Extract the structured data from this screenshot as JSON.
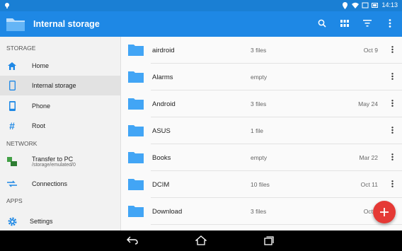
{
  "statusbar": {
    "time": "14:13"
  },
  "toolbar": {
    "title": "Internal storage"
  },
  "sidebar": {
    "sections": {
      "storage": "STORAGE",
      "network": "NETWORK",
      "apps": "APPS"
    },
    "items": [
      {
        "label": "Home",
        "icon": "home-icon"
      },
      {
        "label": "Internal storage",
        "icon": "phone-icon"
      },
      {
        "label": "Phone",
        "icon": "phone-icon"
      },
      {
        "label": "Root",
        "icon": "hash-icon"
      },
      {
        "label": "Transfer to PC",
        "sub": "/storage/emulated/0",
        "icon": "transfer-icon"
      },
      {
        "label": "Connections",
        "icon": "connections-icon"
      },
      {
        "label": "Settings",
        "icon": "gear-icon"
      }
    ]
  },
  "files": [
    {
      "name": "airdroid",
      "meta": "3 files",
      "date": "Oct 9"
    },
    {
      "name": "Alarms",
      "meta": "empty",
      "date": ""
    },
    {
      "name": "Android",
      "meta": "3 files",
      "date": "May 24"
    },
    {
      "name": "ASUS",
      "meta": "1 file",
      "date": ""
    },
    {
      "name": "Books",
      "meta": "empty",
      "date": "Mar 22"
    },
    {
      "name": "DCIM",
      "meta": "10 files",
      "date": "Oct 11"
    },
    {
      "name": "Download",
      "meta": "3 files",
      "date": "Oct 1"
    }
  ],
  "colors": {
    "toolbar": "#1e88e5",
    "folder": "#42a5f5",
    "fab": "#e53935"
  }
}
